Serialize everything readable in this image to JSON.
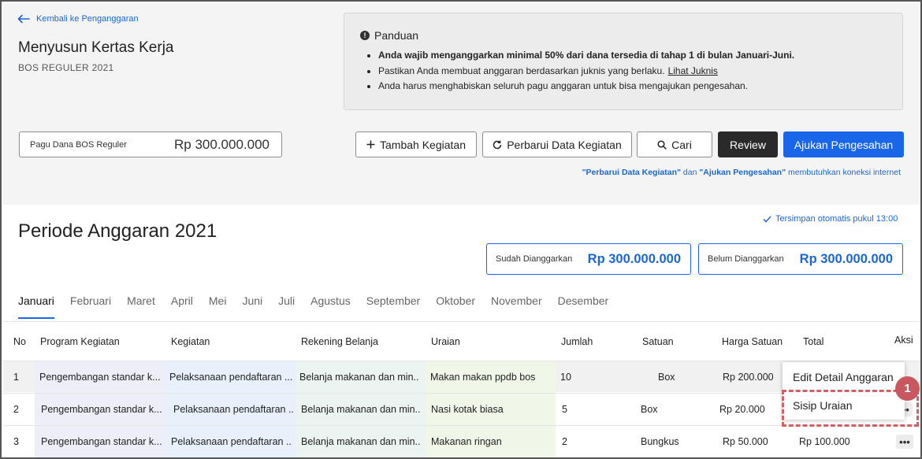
{
  "header": {
    "back_label": "Kembali ke Penganggaran",
    "title": "Menyusun Kertas Kerja",
    "subtitle": "BOS REGULER 2021"
  },
  "guide": {
    "title": "Panduan",
    "items": [
      "Anda wajib menganggarkan minimal 50% dari dana tersedia di tahap 1 di bulan Januari-Juni.",
      "Pastikan Anda membuat anggaran berdasarkan juknis yang berlaku.",
      "Anda harus menghabiskan seluruh pagu anggaran untuk bisa mengajukan pengesahan."
    ],
    "link": "Lihat Juknis"
  },
  "pagu": {
    "label": "Pagu Dana BOS Reguler",
    "value": "Rp 300.000.000"
  },
  "toolbar": {
    "tambah": "Tambah Kegiatan",
    "perbarui": "Perbarui Data Kegiatan",
    "cari": "Cari",
    "review": "Review",
    "ajukan": "Ajukan Pengesahan"
  },
  "note": {
    "q1": "\"Perbarui Data Kegiatan\"",
    "dan": " dan ",
    "q2": "\"Ajukan Pengesahan\"",
    "rest": " membutuhkan koneksi internet"
  },
  "saved": "Tersimpan otomatis pukul 13:00",
  "periode": "Periode Anggaran 2021",
  "summary": {
    "sudah_label": "Sudah Dianggarkan",
    "sudah_value": "Rp 300.000.000",
    "belum_label": "Belum Dianggarkan",
    "belum_value": "Rp 300.000.000"
  },
  "months": [
    "Januari",
    "Februari",
    "Maret",
    "April",
    "Mei",
    "Juni",
    "Juli",
    "Agustus",
    "September",
    "Oktober",
    "November",
    "Desember"
  ],
  "table": {
    "headers": [
      "No",
      "Program Kegiatan",
      "Kegiatan",
      "Rekening Belanja",
      "Uraian",
      "Jumlah",
      "Satuan",
      "Harga Satuan",
      "Total",
      "Aksi"
    ],
    "rows": [
      {
        "no": "1",
        "program": "Pengembangan standar k...",
        "kegiatan": "Pelaksanaan pendaftaran ...",
        "rekening": "Belanja makanan dan min..",
        "uraian": "Makan makan ppdb bos",
        "jumlah": "10",
        "satuan": "Box",
        "harga": "Rp 200.000",
        "total": ""
      },
      {
        "no": "2",
        "program": "Pengembangan standar k...",
        "kegiatan": "Pelaksanaan pendaftaran ..",
        "rekening": "Belanja makanan dan min..",
        "uraian": "Nasi kotak biasa",
        "jumlah": "5",
        "satuan": "Box",
        "harga": "Rp 20.000",
        "total": ""
      },
      {
        "no": "3",
        "program": "Pengembangan standar k...",
        "kegiatan": "Pelaksanaan pendaftaran ..",
        "rekening": "Belanja makanan dan min..",
        "uraian": "Makanan ringan",
        "jumlah": "2",
        "satuan": "Bungkus",
        "harga": "Rp 50.000",
        "total": "Rp 100.000"
      }
    ]
  },
  "menu": {
    "edit": "Edit Detail Anggaran",
    "sisip": "Sisip Uraian"
  },
  "badge": "1",
  "more_glyph": "•••",
  "colors": {
    "primary": "#1a66e8",
    "dark_button": "#2a2a2a",
    "highlight": "#d25f66"
  }
}
